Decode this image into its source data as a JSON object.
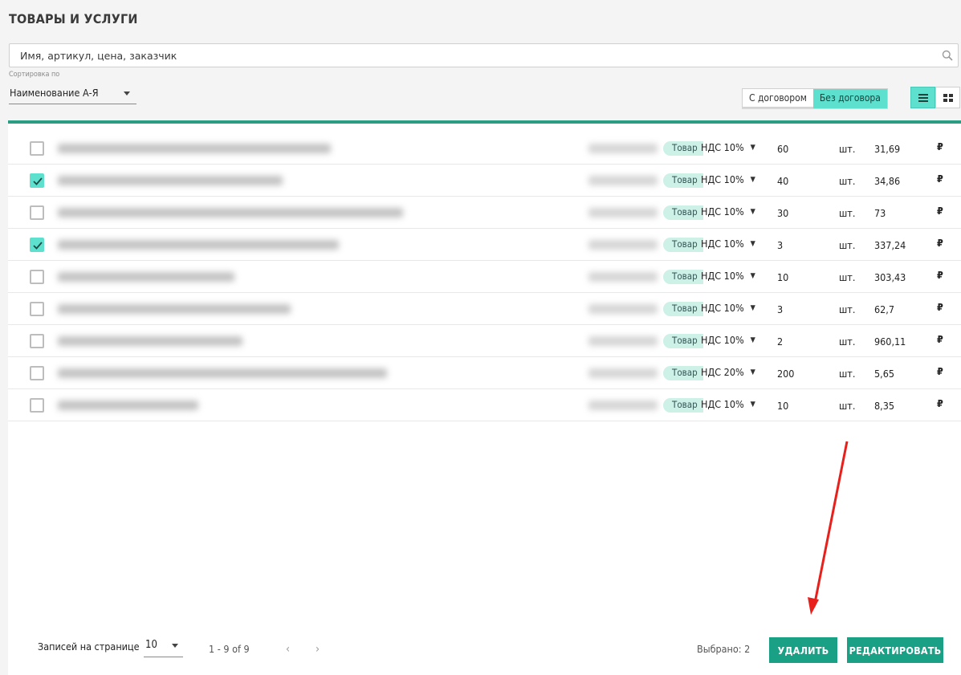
{
  "header": {
    "title": "ТОВАРЫ И УСЛУГИ"
  },
  "search": {
    "placeholder": "Имя, артикул, цена, заказчик"
  },
  "sort": {
    "caption": "Сортировка по",
    "value": "Наименование А-Я"
  },
  "contract_toggle": {
    "with_contract": "С договором",
    "without_contract": "Без договора",
    "active": "without_contract"
  },
  "view_modes": {
    "list_icon": "list-view-icon",
    "grid_icon": "grid-view-icon",
    "active": "list"
  },
  "colors": {
    "accent": "#5ee0cf",
    "primary": "#1aa084",
    "table_border": "#2a9d82",
    "tag_bg": "#cdf0e7",
    "annotation_arrow": "#e8201c"
  },
  "items": [
    {
      "checked": false,
      "tag": "Товар",
      "vat": "НДС 10%",
      "qty": "60",
      "unit": "шт.",
      "price": "31,69",
      "currency": "₽"
    },
    {
      "checked": true,
      "tag": "Товар",
      "vat": "НДС 10%",
      "qty": "40",
      "unit": "шт.",
      "price": "34,86",
      "currency": "₽"
    },
    {
      "checked": false,
      "tag": "Товар",
      "vat": "НДС 10%",
      "qty": "30",
      "unit": "шт.",
      "price": "73",
      "currency": "₽"
    },
    {
      "checked": true,
      "tag": "Товар",
      "vat": "НДС 10%",
      "qty": "3",
      "unit": "шт.",
      "price": "337,24",
      "currency": "₽"
    },
    {
      "checked": false,
      "tag": "Товар",
      "vat": "НДС 10%",
      "qty": "10",
      "unit": "шт.",
      "price": "303,43",
      "currency": "₽"
    },
    {
      "checked": false,
      "tag": "Товар",
      "vat": "НДС 10%",
      "qty": "3",
      "unit": "шт.",
      "price": "62,7",
      "currency": "₽"
    },
    {
      "checked": false,
      "tag": "Товар",
      "vat": "НДС 10%",
      "qty": "2",
      "unit": "шт.",
      "price": "960,11",
      "currency": "₽"
    },
    {
      "checked": false,
      "tag": "Товар",
      "vat": "НДС 20%",
      "qty": "200",
      "unit": "шт.",
      "price": "5,65",
      "currency": "₽"
    },
    {
      "checked": false,
      "tag": "Товар",
      "vat": "НДС 10%",
      "qty": "10",
      "unit": "шт.",
      "price": "8,35",
      "currency": "₽"
    }
  ],
  "footer": {
    "rows_per_page_label": "Записей на странице",
    "rows_per_page_value": "10",
    "range": "1 - 9 of 9",
    "prev": "‹",
    "next": "›",
    "selected_label": "Выбрано: 2",
    "delete_label": "УДАЛИТЬ",
    "edit_label": "РЕДАКТИРОВАТЬ"
  }
}
